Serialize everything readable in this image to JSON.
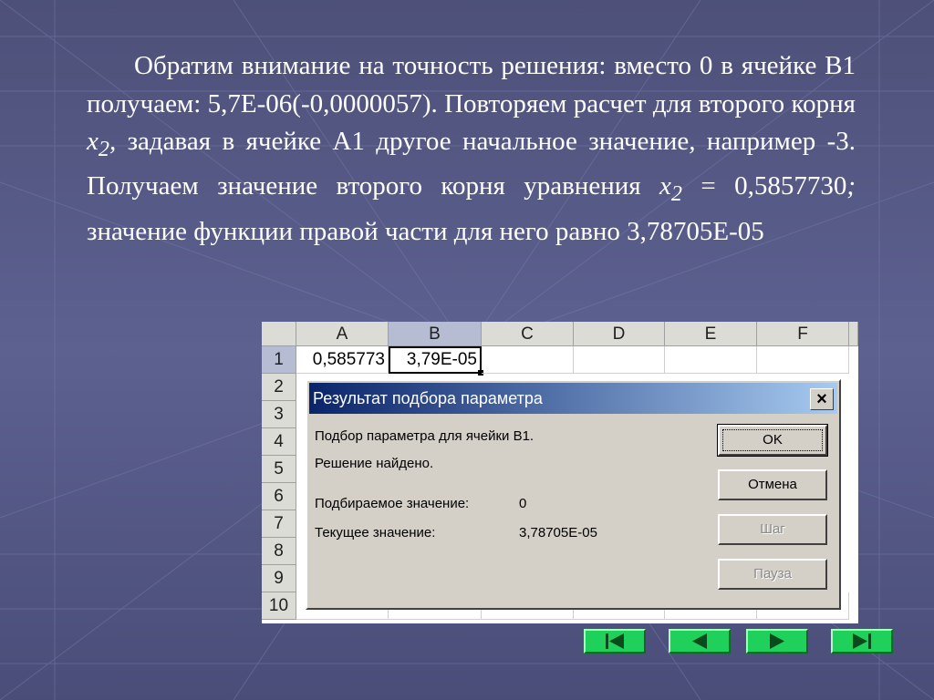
{
  "slide": {
    "paragraph_part1": "Обратим внимание на  точность решения:  вместо 0 в ячейке B1 получаем: 5,7E-06(-0,0000057). Повторяем расчет для второго корня ",
    "x2_var_1": "x",
    "x2_sub_1": "2",
    "x2_comma": ",",
    "paragraph_part2": " задавая в ячейке А1 другое начальное значение, например -3. Получаем значение второго корня уравнения ",
    "x2_var_2": "x",
    "x2_sub_2": "2",
    "paragraph_part3": " = 0,5857730",
    "semicolon": ";",
    "paragraph_part4": " значение функции правой части для него равно 3,78705Е-05"
  },
  "spreadsheet": {
    "columns": [
      "A",
      "B",
      "C",
      "D",
      "E",
      "F"
    ],
    "rows": [
      "1",
      "2",
      "3",
      "4",
      "5",
      "6",
      "7",
      "8",
      "9",
      "10"
    ],
    "cell_a1": "0,585773",
    "cell_b1": "3,79E-05",
    "selected_column": "B",
    "selected_row": "1"
  },
  "dialog": {
    "title": "Результат подбора параметра",
    "close_label": "×",
    "line1": "Подбор параметра для ячейки B1.",
    "line2": "Решение найдено.",
    "target_label": "Подбираемое значение:",
    "target_value": "0",
    "current_label": "Текущее значение:",
    "current_value": "3,78705E-05",
    "buttons": {
      "ok": "OK",
      "cancel": "Отмена",
      "step": "Шаг",
      "pause": "Пауза"
    }
  },
  "navigation": {
    "icons": [
      "first-slide-icon",
      "previous-slide-icon",
      "next-slide-icon",
      "last-slide-icon"
    ]
  },
  "colors": {
    "background": "#5a5e8c",
    "nav_green": "#1fd05a",
    "dialog_title": "#0a246a"
  }
}
